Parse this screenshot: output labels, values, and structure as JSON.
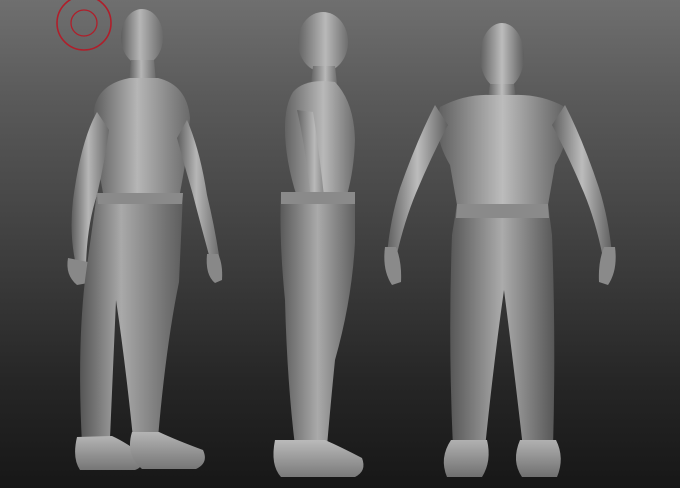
{
  "app": {
    "canvas_background": [
      "#6f6f6f",
      "#171717"
    ],
    "material_color": "#9a9a9a"
  },
  "brush_cursor": {
    "icon": "brush-ring-icon",
    "color": "#b01e2a"
  },
  "figures": [
    {
      "view": "three-quarter",
      "icon": "sculpt-figure-icon"
    },
    {
      "view": "side",
      "icon": "sculpt-figure-icon"
    },
    {
      "view": "front",
      "icon": "sculpt-figure-icon"
    }
  ]
}
